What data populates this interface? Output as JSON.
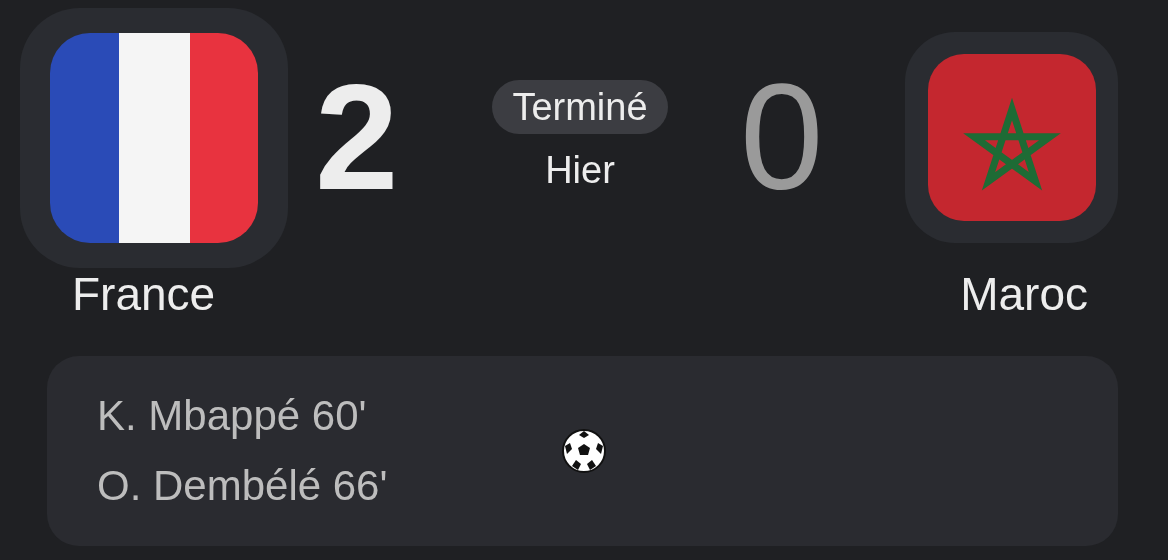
{
  "home": {
    "name": "France",
    "score": "2",
    "winner": true
  },
  "status": {
    "label": "Terminé",
    "date": "Hier"
  },
  "away": {
    "name": "Maroc",
    "score": "0",
    "winner": false
  },
  "scorers": [
    {
      "text": "K. Mbappé 60'"
    },
    {
      "text": "O. Dembélé 66'"
    }
  ]
}
